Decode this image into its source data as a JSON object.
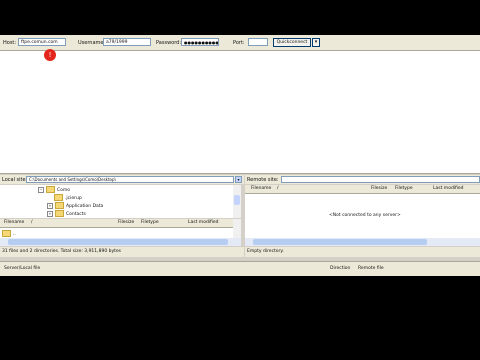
{
  "quickconnect": {
    "host_label": "Host:",
    "host_value": "ftpe.comun.com",
    "username_label": "Username:",
    "username_value": "a79/1999",
    "password_label": "Password:",
    "password_value": "●●●●●●●●●●",
    "port_label": "Port:",
    "port_value": "",
    "connect_label": "Quickconnect",
    "dropdown_glyph": "▾"
  },
  "marker": {
    "text": "!"
  },
  "local": {
    "site_label": "Local site:",
    "path": "C:\\Documents and Settings\\Como\\Desktop\\",
    "tree": [
      {
        "label": "Como",
        "expander": "−"
      },
      {
        "label": ".jcierup",
        "expander": ""
      },
      {
        "label": "Application Data",
        "expander": "+"
      },
      {
        "label": "Contacts",
        "expander": "+"
      }
    ],
    "columns": {
      "filename": "Filename",
      "sort_glyph": "/",
      "filesize": "Filesize",
      "filetype": "Filetype",
      "last_modified": "Last modified"
    },
    "first_row": "..",
    "status": "31 files and 2 directories. Total size: 3,911,890 bytes"
  },
  "remote": {
    "site_label": "Remote site:",
    "path": "",
    "columns": {
      "filename": "Filename",
      "sort_glyph": "/",
      "filesize": "Filesize",
      "filetype": "Filetype",
      "last_modified": "Last modified"
    },
    "message": "<Not connected to any server>",
    "status": "Empty directory."
  },
  "queue": {
    "server_local": "Server/Local file",
    "direction": "Direction",
    "remote_file": "Remote file"
  }
}
